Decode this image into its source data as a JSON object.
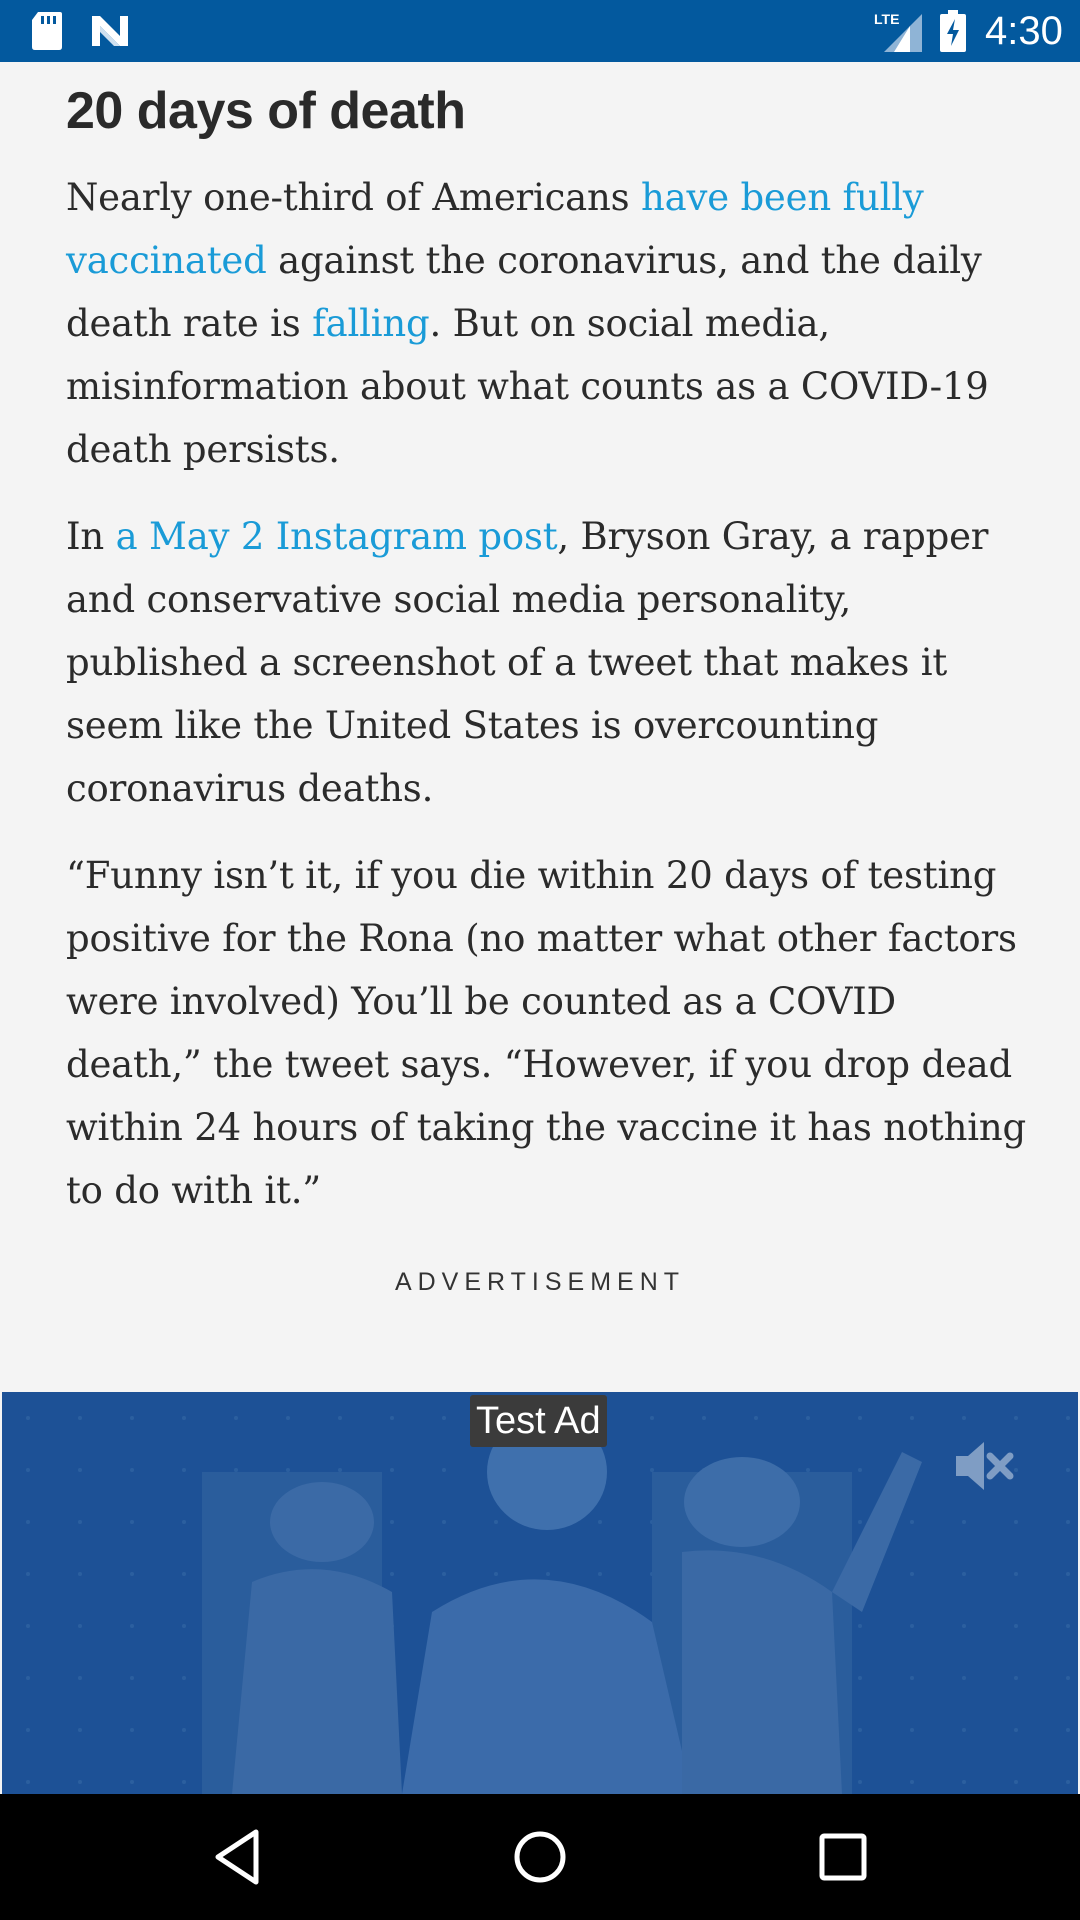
{
  "status_bar": {
    "time": "4:30",
    "network": "LTE",
    "icons": [
      "sd-card-icon",
      "notification-n-icon",
      "lte-signal-icon",
      "battery-charging-icon"
    ]
  },
  "article": {
    "heading": "20 days of death",
    "paragraphs": [
      {
        "segments": [
          {
            "text": "Nearly one-third of Americans ",
            "link": false
          },
          {
            "text": "have been fully vaccinated",
            "link": true
          },
          {
            "text": " against the coronavirus, and the daily death rate is ",
            "link": false
          },
          {
            "text": "falling",
            "link": true
          },
          {
            "text": ". But on social media, misinformation about what counts as a COVID-19 death persists.",
            "link": false
          }
        ]
      },
      {
        "segments": [
          {
            "text": "In ",
            "link": false
          },
          {
            "text": "a May 2 Instagram post",
            "link": true
          },
          {
            "text": ", Bryson Gray, a rapper and conservative social media personality, published a screenshot of a tweet that makes it seem like the United States is overcounting coronavirus deaths.",
            "link": false
          }
        ]
      },
      {
        "segments": [
          {
            "text": "“Funny isn’t it, if you die within 20 days of testing positive for the Rona (no matter what other factors were involved) You’ll be counted as a COVID death,” the tweet says. “However, if you drop dead within 24 hours of taking the vaccine it has nothing to do with it.”",
            "link": false
          }
        ]
      }
    ]
  },
  "advertisement": {
    "label": "ADVERTISEMENT",
    "tag": "Test Ad",
    "background_color": "#1d5196",
    "mute_icon": "volume-mute-icon"
  },
  "nav_bar": {
    "buttons": [
      "back-icon",
      "home-icon",
      "recents-icon"
    ]
  },
  "colors": {
    "status_bar": "#03599e",
    "link": "#1a9bd7",
    "text": "#2b2b2b",
    "page_bg": "#f4f4f4"
  }
}
